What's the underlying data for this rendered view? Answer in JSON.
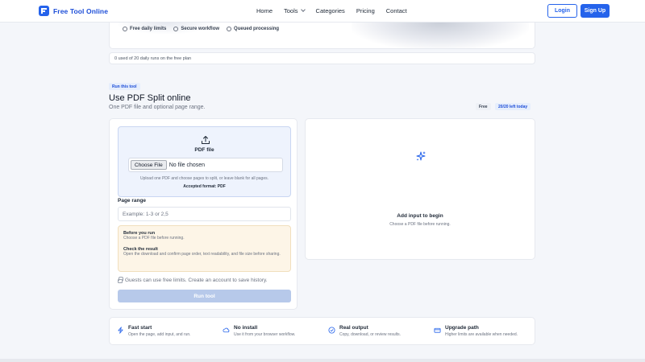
{
  "nav": {
    "brand": "Free Tool Online",
    "items": [
      {
        "label": "Home"
      },
      {
        "label": "Tools"
      },
      {
        "label": "Categories"
      },
      {
        "label": "Pricing"
      },
      {
        "label": "Contact"
      }
    ],
    "login_label": "Login",
    "signup_label": "Sign Up"
  },
  "hero": {
    "features": [
      "Free daily limits",
      "Secure workflow",
      "Queued processing"
    ]
  },
  "usage_text": "0 used of 20 daily runs on the free plan",
  "tool": {
    "badge": "Run this tool",
    "title": "Use PDF Split online",
    "subtitle": "One PDF file and optional page range.",
    "plan_pill": "Free",
    "remaining_pill": "20/20 left today"
  },
  "form": {
    "file_label": "PDF file",
    "file_button": "Choose File",
    "file_status": "No file chosen",
    "file_help": "Upload one PDF and choose pages to split, or leave blank for all pages.",
    "file_format": "Accepted format: PDF",
    "range_label": "Page range",
    "range_placeholder": "Example: 1-3 or 2,5",
    "note": {
      "before_title": "Before you run",
      "before_text": "Choose a PDF file before running.",
      "check_title": "Check the result",
      "check_text": "Open the download and confirm page order, text readability, and file size before sharing."
    },
    "guest_text": "Guests can use free limits. Create an account to save history.",
    "run_label": "Run tool"
  },
  "output": {
    "empty_title": "Add input to begin",
    "empty_text": "Choose a PDF file before running."
  },
  "benefits": [
    {
      "title": "Fast start",
      "text": "Open the page, add input, and run.",
      "icon": "lightning-icon"
    },
    {
      "title": "No install",
      "text": "Use it from your browser workflow.",
      "icon": "cloud-icon"
    },
    {
      "title": "Real output",
      "text": "Copy, download, or review results.",
      "icon": "check-circle-icon"
    },
    {
      "title": "Upgrade path",
      "text": "Higher limits are available when needed.",
      "icon": "card-icon"
    }
  ],
  "colors": {
    "accent": "#2563eb",
    "accent_soft": "#e6eefc",
    "note_bg": "#fdf5e7",
    "run_disabled": "#b7c9ea"
  }
}
